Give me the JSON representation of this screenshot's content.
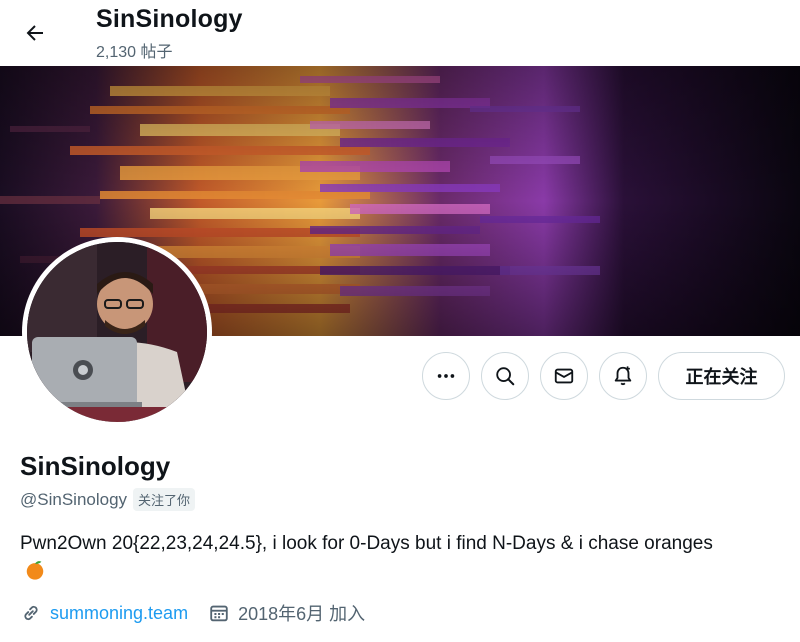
{
  "header": {
    "display_name": "SinSinology",
    "post_count": "2,130 帖子"
  },
  "profile": {
    "display_name": "SinSinology",
    "handle": "@SinSinology",
    "follows_you_badge": "关注了你",
    "bio_text": "Pwn2Own 20{22,23,24,24.5}, i look for 0-Days but i find N-Days & i chase oranges",
    "bio_emoji": "orange-emoji",
    "website": "summoning.team",
    "joined": "2018年6月 加入"
  },
  "actions": {
    "more_icon": "more-icon",
    "search_icon": "search-icon",
    "message_icon": "message-icon",
    "notify_icon": "notification-bell-icon",
    "follow_label": "正在关注"
  },
  "colors": {
    "text_primary": "#0f1419",
    "text_secondary": "#536471",
    "link": "#1d9bf0",
    "border": "#cfd9de"
  }
}
